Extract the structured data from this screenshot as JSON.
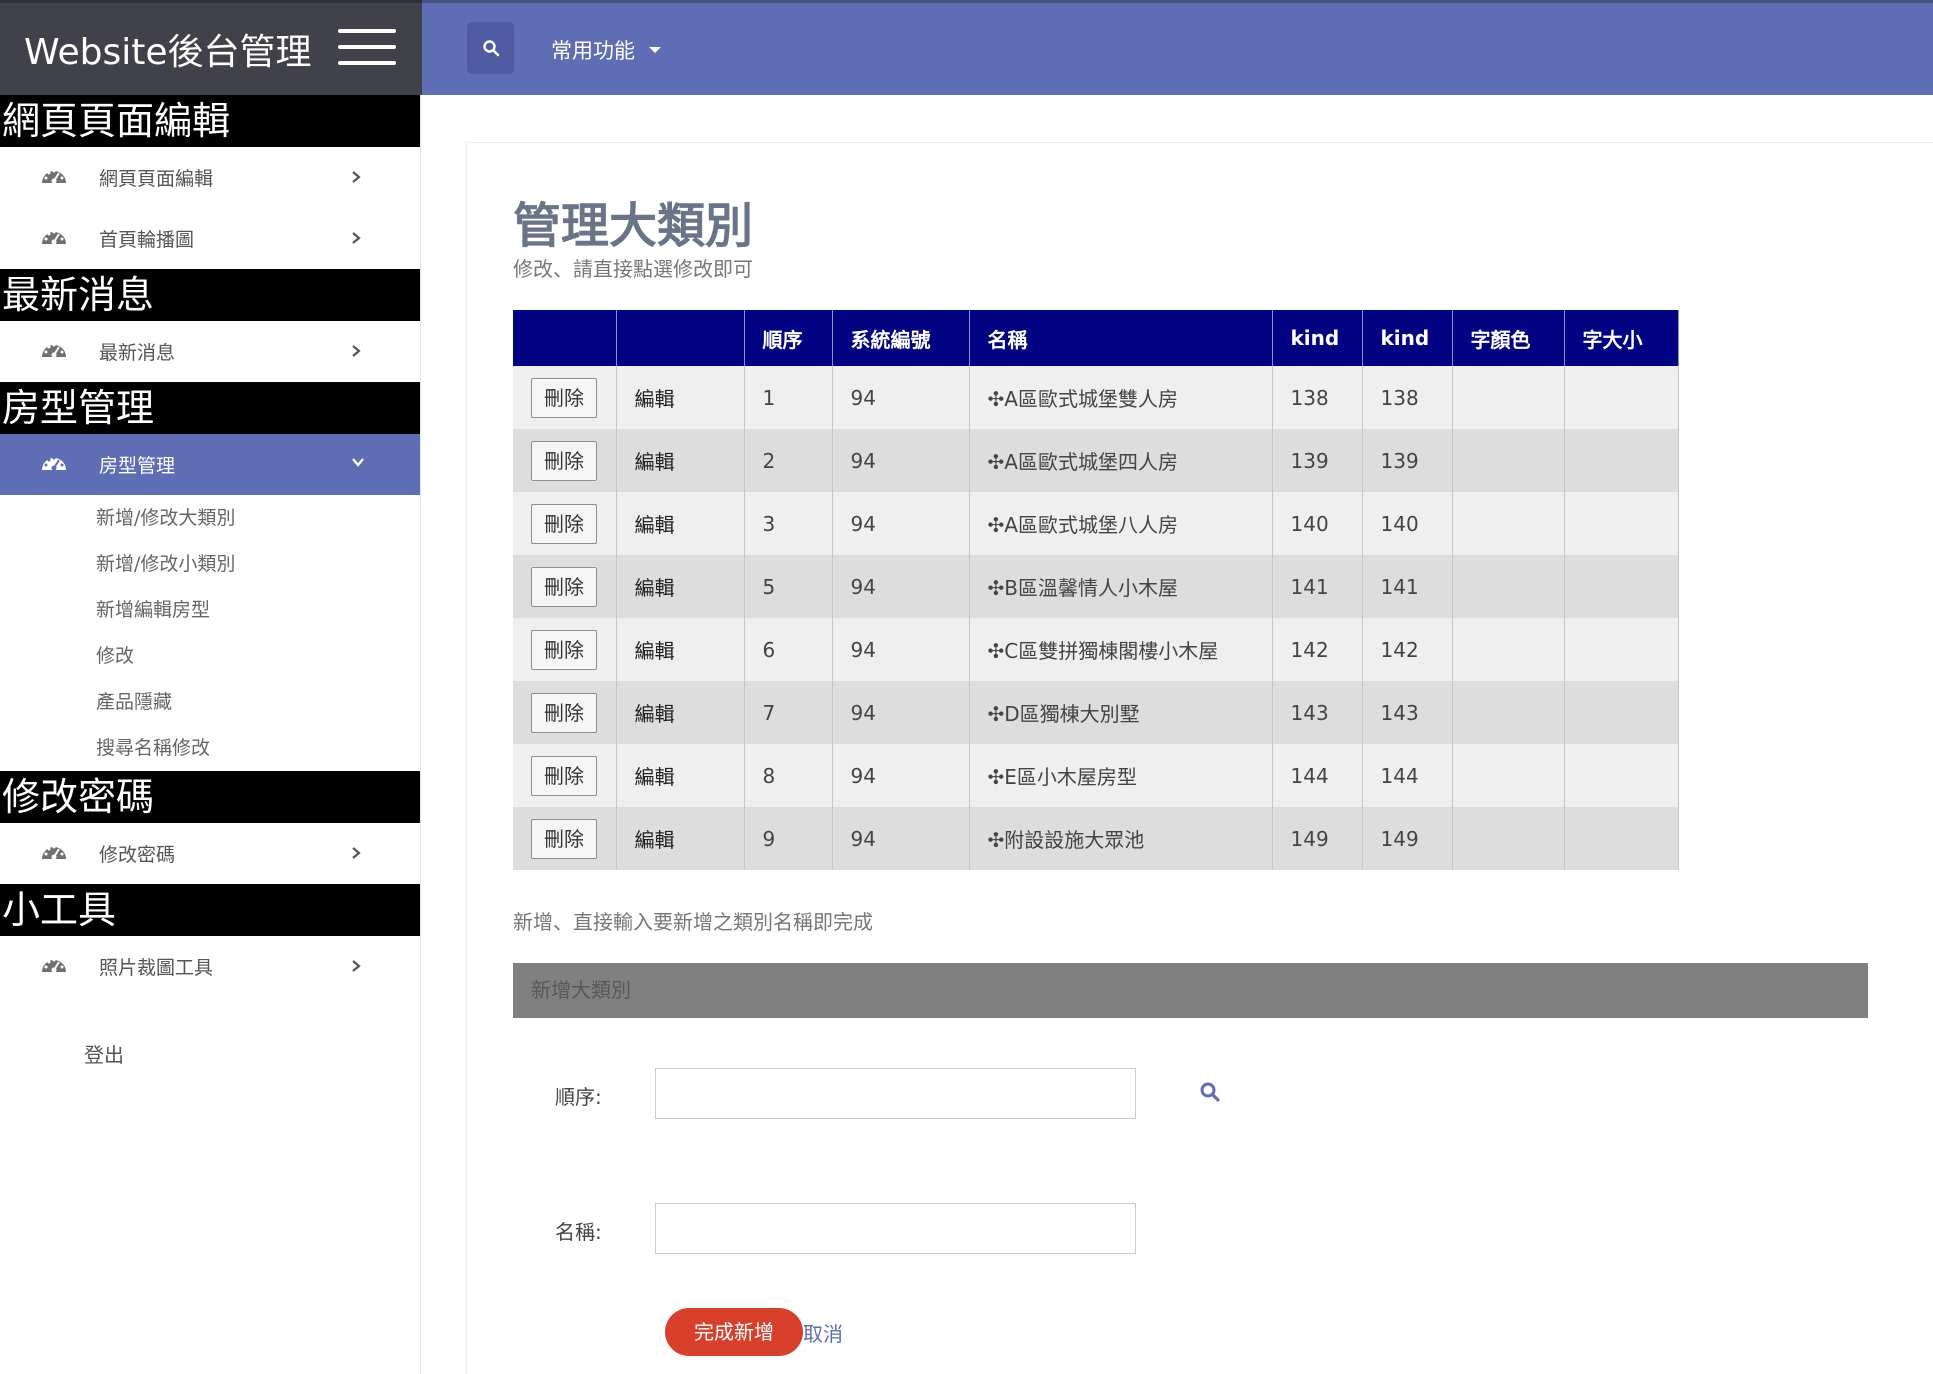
{
  "brand": "Website後台管理",
  "topnav": {
    "common_label": "常用功能"
  },
  "sidebar": {
    "sections": [
      {
        "title": "網頁頁面編輯",
        "items": [
          "網頁頁面編輯",
          "首頁輪播圖"
        ]
      },
      {
        "title": "最新消息",
        "items": [
          "最新消息"
        ]
      },
      {
        "title": "房型管理",
        "items": [
          "房型管理"
        ]
      },
      {
        "title": "修改密碼",
        "items": [
          "修改密碼"
        ]
      },
      {
        "title": "小工具",
        "items": [
          "照片裁圖工具"
        ]
      }
    ],
    "subitems": [
      "新增/修改大類別",
      "新增/修改小類別",
      "新增編輯房型",
      "修改",
      "產品隱藏",
      "搜尋名稱修改"
    ],
    "logout": "登出"
  },
  "main": {
    "title": "管理大類別",
    "hint_edit": "修改、請直接點選修改即可",
    "hint_add": "新增、直接輸入要新增之類別名稱即完成",
    "add_bar_title": "新增大類別",
    "order_label": "順序:",
    "name_label": "名稱:",
    "submit_label": "完成新增",
    "cancel_label": "取消"
  },
  "table": {
    "headers": [
      "",
      "",
      "順序",
      "系統編號",
      "名稱",
      "kind",
      "kind",
      "字顏色",
      "字大小"
    ],
    "delete_label": "刪除",
    "edit_label": "編輯",
    "rows": [
      {
        "order": "1",
        "sysno": "94",
        "name": "✣A區歐式城堡雙人房",
        "kind1": "138",
        "kind2": "138",
        "color": "",
        "size": ""
      },
      {
        "order": "2",
        "sysno": "94",
        "name": "✣A區歐式城堡四人房",
        "kind1": "139",
        "kind2": "139",
        "color": "",
        "size": ""
      },
      {
        "order": "3",
        "sysno": "94",
        "name": "✣A區歐式城堡八人房",
        "kind1": "140",
        "kind2": "140",
        "color": "",
        "size": ""
      },
      {
        "order": "5",
        "sysno": "94",
        "name": "✣B區溫馨情人小木屋",
        "kind1": "141",
        "kind2": "141",
        "color": "",
        "size": ""
      },
      {
        "order": "6",
        "sysno": "94",
        "name": "✣C區雙拼獨棟閣樓小木屋",
        "kind1": "142",
        "kind2": "142",
        "color": "",
        "size": ""
      },
      {
        "order": "7",
        "sysno": "94",
        "name": "✣D區獨棟大別墅",
        "kind1": "143",
        "kind2": "143",
        "color": "",
        "size": ""
      },
      {
        "order": "8",
        "sysno": "94",
        "name": "✣E區小木屋房型",
        "kind1": "144",
        "kind2": "144",
        "color": "",
        "size": ""
      },
      {
        "order": "9",
        "sysno": "94",
        "name": "✣附設設施大眾池",
        "kind1": "149",
        "kind2": "149",
        "color": "",
        "size": ""
      }
    ]
  },
  "colors": {
    "nav": "#5f6db5",
    "brand_bg": "#414249",
    "table_header": "#010382",
    "submit": "#d9402b"
  },
  "icons": {
    "dashboard": "dashboard-icon",
    "chevron": "chevron-right-icon",
    "search": "search-icon"
  }
}
